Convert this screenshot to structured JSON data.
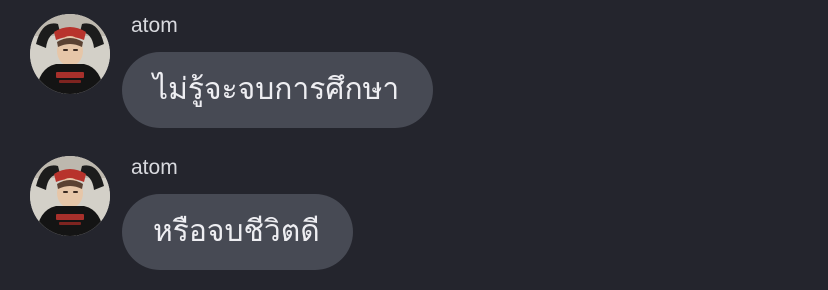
{
  "messages": [
    {
      "sender": "atom",
      "text": "ไม่รู้จะจบการศึกษา",
      "avatar_icon": "user-photo-avatar"
    },
    {
      "sender": "atom",
      "text": "หรือจบชีวิตดี",
      "avatar_icon": "user-photo-avatar"
    }
  ],
  "colors": {
    "background": "#24252d",
    "bubble": "#474a54",
    "text": "#eeeef2",
    "sender_name": "#d8d9de"
  }
}
